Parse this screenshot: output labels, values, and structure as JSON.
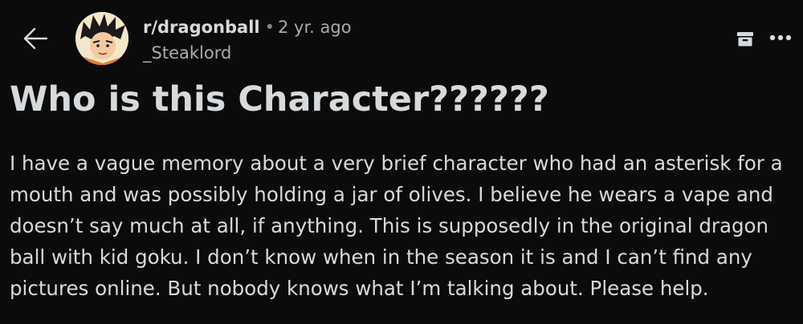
{
  "post": {
    "subreddit": "r/dragonball",
    "separator": "•",
    "age": "2 yr. ago",
    "username": "_Steaklord",
    "title": "Who is this Character??????",
    "body": "I have a vague memory about a very brief character who had an asterisk for a mouth and was possibly holding a jar of olives. I believe he wears a vape and doesn’t say much at all, if anything. This is supposedly in the original dragon ball with kid goku. I don’t know when in the season it is and I can’t find any pictures online. But nobody knows what I’m talking about. Please help."
  },
  "icons": {
    "back": "back-arrow-icon",
    "archive": "archive-icon",
    "more": "more-options-icon",
    "avatar": "subreddit-avatar-goku"
  },
  "colors": {
    "background": "#0b0b0b",
    "text": "#d7dadc",
    "muted": "#a8aaab"
  }
}
